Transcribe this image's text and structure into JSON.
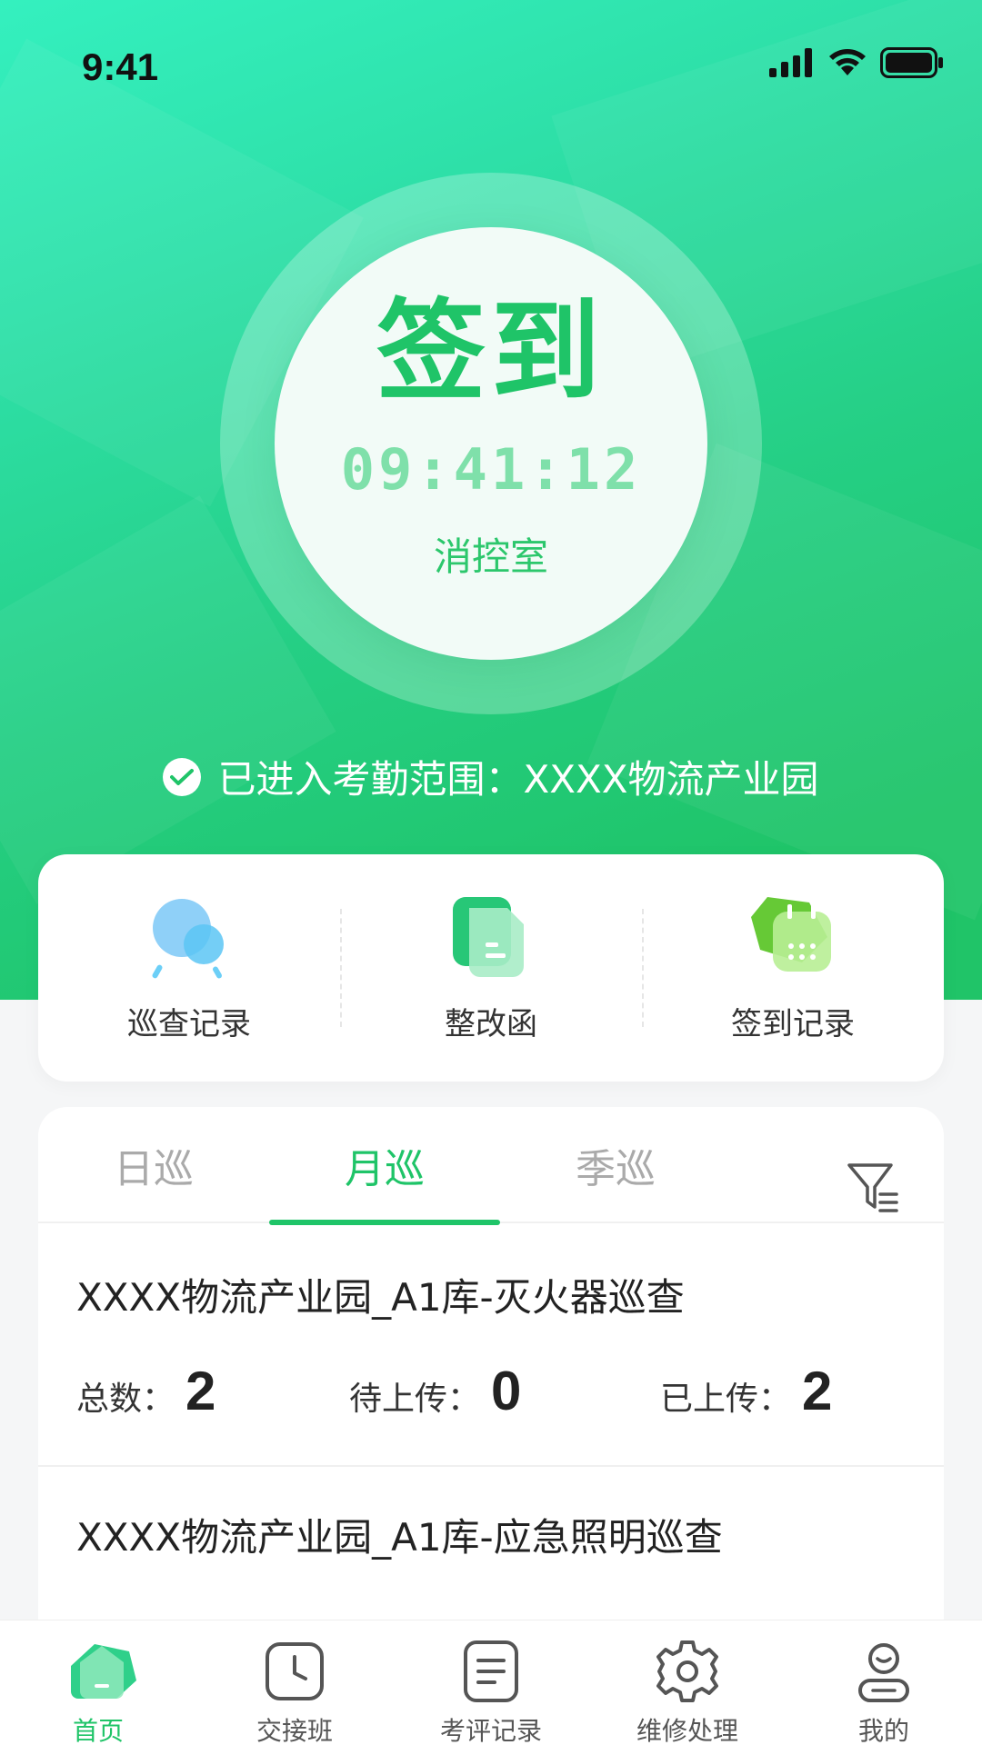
{
  "status": {
    "time": "9:41"
  },
  "signin": {
    "title": "签到",
    "time": "09:41:12",
    "location": "消控室",
    "range_text": "已进入考勤范围：XXXX物流产业园"
  },
  "quick_actions": [
    {
      "label": "巡查记录",
      "icon": "magnifier-icon"
    },
    {
      "label": "整改函",
      "icon": "document-icon"
    },
    {
      "label": "签到记录",
      "icon": "calendar-icon"
    }
  ],
  "tabs": [
    {
      "label": "日巡",
      "active": false
    },
    {
      "label": "月巡",
      "active": true
    },
    {
      "label": "季巡",
      "active": false
    }
  ],
  "tasks": [
    {
      "title": "XXXX物流产业园_A1库-灭火器巡查",
      "total_label": "总数：",
      "total": "2",
      "pending_label": "待上传：",
      "pending": "0",
      "uploaded_label": "已上传：",
      "uploaded": "2"
    },
    {
      "title": "XXXX物流产业园_A1库-应急照明巡查"
    }
  ],
  "tabbar": [
    {
      "label": "首页",
      "active": true,
      "icon": "home-icon"
    },
    {
      "label": "交接班",
      "active": false,
      "icon": "clock-icon"
    },
    {
      "label": "考评记录",
      "active": false,
      "icon": "list-icon"
    },
    {
      "label": "维修处理",
      "active": false,
      "icon": "gear-icon"
    },
    {
      "label": "我的",
      "active": false,
      "icon": "person-icon"
    }
  ],
  "colors": {
    "accent": "#1fc468",
    "hero_top": "#34f0bf",
    "hero_bottom": "#20c468"
  }
}
